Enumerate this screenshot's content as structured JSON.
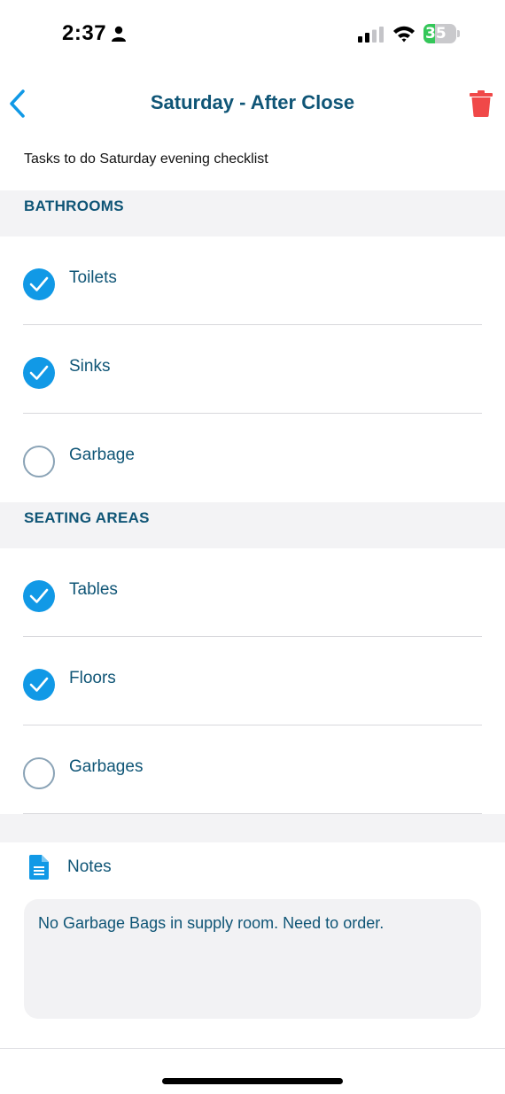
{
  "status_bar": {
    "time": "2:37",
    "battery": "35",
    "battery_level": 0.35
  },
  "header": {
    "title": "Saturday - After Close",
    "back_icon": "chevron-left-icon",
    "delete_icon": "trash-icon"
  },
  "description": "Tasks to do Saturday evening checklist",
  "sections": [
    {
      "title": "BATHROOMS",
      "tasks": [
        {
          "label": "Toilets",
          "checked": true
        },
        {
          "label": "Sinks",
          "checked": true
        },
        {
          "label": "Garbage",
          "checked": false
        }
      ]
    },
    {
      "title": "SEATING AREAS",
      "tasks": [
        {
          "label": "Tables",
          "checked": true
        },
        {
          "label": "Floors",
          "checked": true
        },
        {
          "label": "Garbages",
          "checked": false
        }
      ]
    }
  ],
  "notes": {
    "label": "Notes",
    "icon": "document-icon",
    "text": "No Garbage Bags in supply room. Need to order."
  },
  "colors": {
    "accent": "#1199e6",
    "title": "#0f5576",
    "delete": "#f04848",
    "section_bg": "#f3f3f5"
  }
}
